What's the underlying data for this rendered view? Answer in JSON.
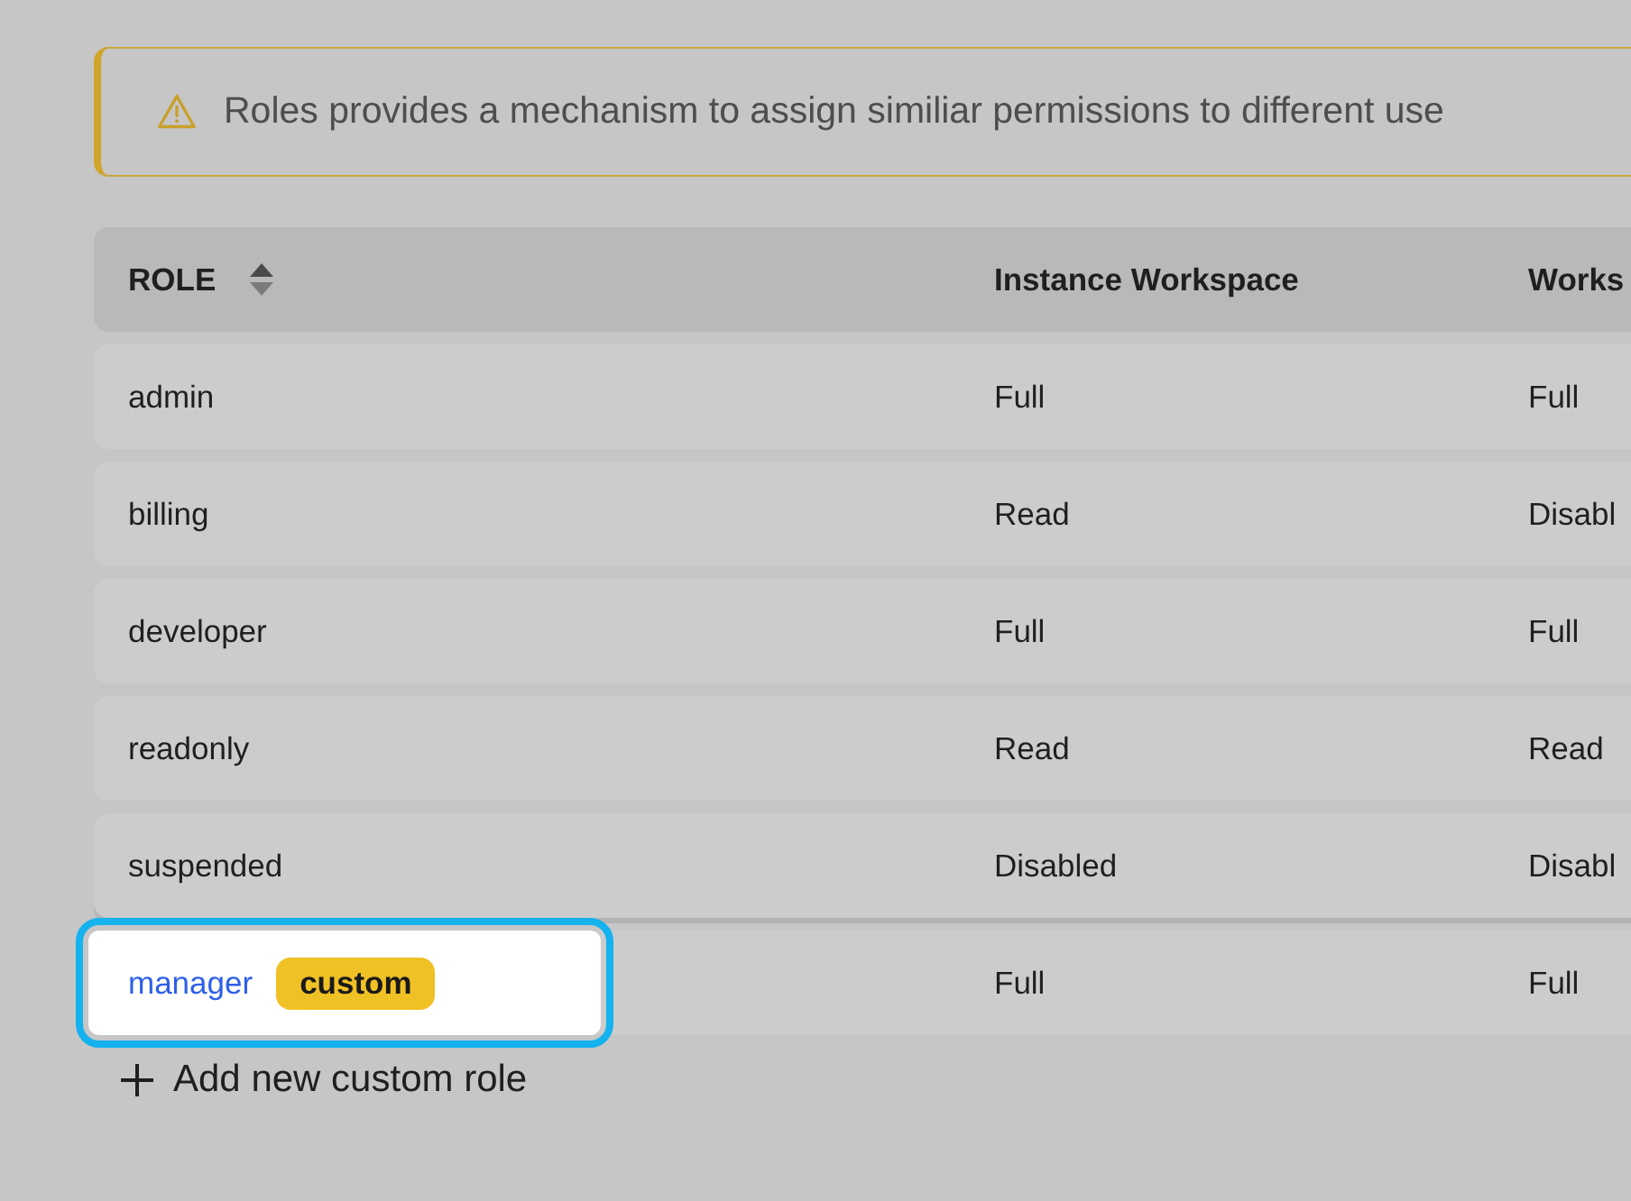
{
  "banner": {
    "text": "Roles provides a mechanism to assign similiar permissions to different use"
  },
  "table": {
    "columns": [
      {
        "label": "ROLE",
        "sortable": true
      },
      {
        "label": "Instance Workspace"
      },
      {
        "label": "Works"
      }
    ],
    "rows": [
      {
        "kind": "builtin",
        "cells": [
          "admin",
          "Full",
          "Full"
        ],
        "highlighted": false
      },
      {
        "kind": "builtin",
        "cells": [
          "billing",
          "Read",
          "Disabl"
        ],
        "highlighted": false
      },
      {
        "kind": "builtin",
        "cells": [
          "developer",
          "Full",
          "Full"
        ],
        "highlighted": false
      },
      {
        "kind": "builtin",
        "cells": [
          "readonly",
          "Read",
          "Read"
        ],
        "highlighted": false
      },
      {
        "kind": "builtin",
        "cells": [
          "suspended",
          "Disabled",
          "Disabl"
        ],
        "highlighted": false
      },
      {
        "kind": "custom",
        "cells": [
          "manager",
          "Full",
          "Full"
        ],
        "badge": "custom",
        "highlighted": true
      }
    ]
  },
  "add_button": {
    "label": "Add new custom role"
  }
}
